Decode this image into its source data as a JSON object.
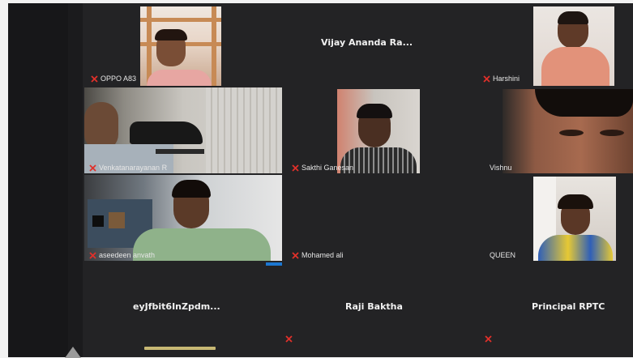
{
  "participants": {
    "oppo": "OPPO A83",
    "vijay": "Vijay Ananda Ra...",
    "harshini": "Harshini",
    "venkata": "Venkatanarayanan R",
    "sakthi": "Sakthi Ganesan",
    "vishnu": "Vishnu",
    "aseedeen": "aseedeen anvath",
    "mohamed": "Mohamed ali",
    "queen": "QUEEN",
    "ey": "eyJfbit6InZpdm...",
    "raji": "Raji Baktha",
    "principal": "Principal RPTC"
  },
  "colors": {
    "muted_icon": "#e0302a",
    "tile_bg": "#232325",
    "frame_bg": "#1b1b1d",
    "active_bar": "#c7b874",
    "accent_button": "#1b77d2"
  }
}
